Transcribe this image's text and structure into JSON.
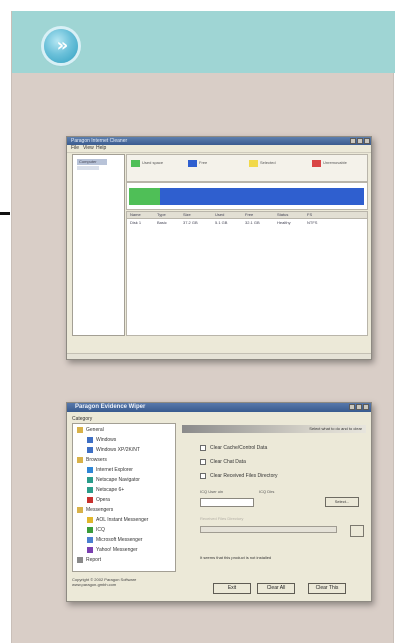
{
  "header": {
    "accent": "#9fd5d4",
    "badge_icon": "double-chevron-right-icon",
    "badge_glyph": "»"
  },
  "screenshot1": {
    "title": "Paragon Internet Cleaner",
    "menu": [
      "File",
      "View",
      "Help"
    ],
    "tree": [
      "Computer"
    ],
    "legend": [
      "Used space",
      "Free",
      "Selected",
      "Unremovable"
    ],
    "legend_colors": [
      "#4fbf57",
      "#2f5fcf",
      "#f1d94a",
      "#d94545"
    ],
    "columns": [
      "Name",
      "Type",
      "Size",
      "Used",
      "Free",
      "Status",
      "FS"
    ],
    "rows": [
      [
        "Disk 1",
        "Basic",
        "37.2 GB",
        "5.1 GB",
        "32.1 GB",
        "Healthy",
        "NTFS"
      ]
    ]
  },
  "screenshot2": {
    "title": "Paragon Evidence Wiper",
    "category_label": "Category",
    "tree": [
      {
        "label": "General",
        "level": 0,
        "icon": "folder-icon"
      },
      {
        "label": "Windows",
        "level": 1,
        "icon": "windows-icon"
      },
      {
        "label": "Windows XP/2K/NT",
        "level": 1,
        "icon": "windows-icon"
      },
      {
        "label": "Browsers",
        "level": 0,
        "icon": "folder-icon"
      },
      {
        "label": "Internet Explorer",
        "level": 1,
        "icon": "ie-icon"
      },
      {
        "label": "Netscape Navigator",
        "level": 1,
        "icon": "netscape-icon"
      },
      {
        "label": "Netscape 6+",
        "level": 1,
        "icon": "netscape-icon"
      },
      {
        "label": "Opera",
        "level": 1,
        "icon": "opera-icon"
      },
      {
        "label": "Messengers",
        "level": 0,
        "icon": "folder-icon"
      },
      {
        "label": "AOL Instant Messenger",
        "level": 1,
        "icon": "aim-icon"
      },
      {
        "label": "ICQ",
        "level": 1,
        "icon": "icq-icon"
      },
      {
        "label": "Microsoft Messenger",
        "level": 1,
        "icon": "msn-icon"
      },
      {
        "label": "Yahoo! Messenger",
        "level": 1,
        "icon": "yahoo-icon"
      },
      {
        "label": "Report",
        "level": 0,
        "icon": "report-icon"
      }
    ],
    "band_text": "Select what to do and to clear",
    "options": [
      "Clear Cache/Control Data",
      "Clear Chat Data",
      "Clear Received Files Directory"
    ],
    "label_size_on": "ICQ User uin",
    "label_size_off": "ICQ Dirs",
    "select_button": "Select...",
    "dim_label": "Received Files Directory",
    "admin_note": "It seems that this product is not installed",
    "copyright": [
      "Copyright © 2002 Paragon Software",
      "www.paragon-gmbh.com"
    ],
    "buttons": [
      "Exit",
      "Clear All",
      "Clear This"
    ]
  }
}
